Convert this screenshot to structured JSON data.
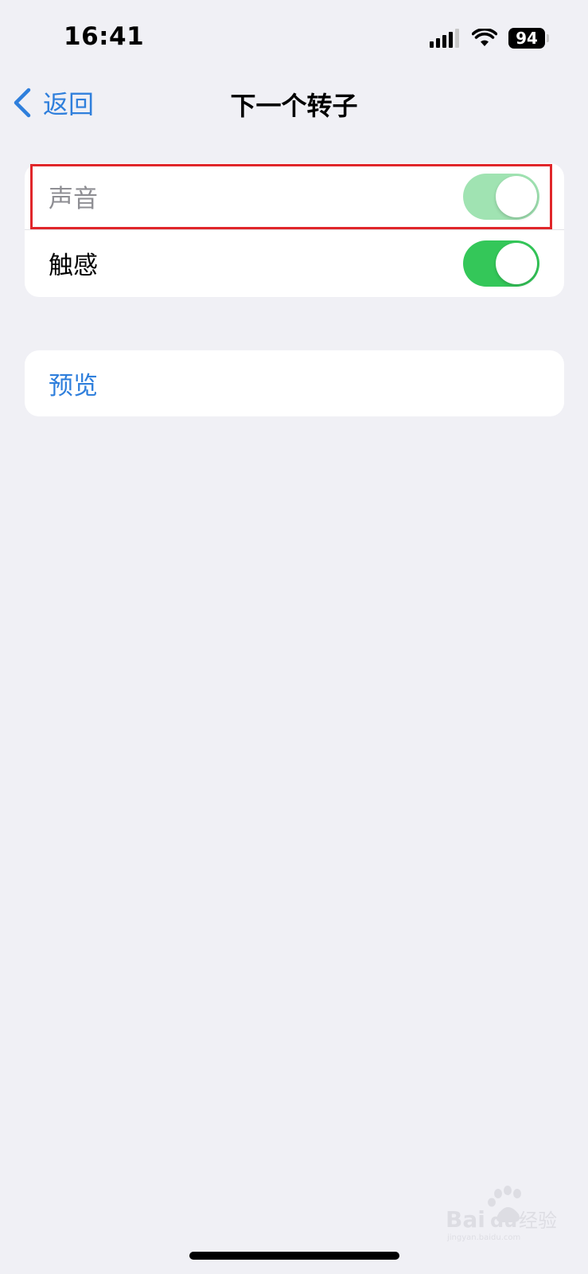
{
  "status_bar": {
    "time": "16:41",
    "battery": "94",
    "icons": [
      "signal-icon",
      "wifi-icon",
      "battery-icon"
    ]
  },
  "nav": {
    "back_label": "返回",
    "title": "下一个转子"
  },
  "group1": {
    "rows": [
      {
        "label": "声音",
        "toggle_on": true,
        "dimmed": true
      },
      {
        "label": "触感",
        "toggle_on": true,
        "dimmed": false
      }
    ]
  },
  "group2": {
    "rows": [
      {
        "label": "预览"
      }
    ]
  },
  "colors": {
    "background": "#f0f0f5",
    "accent_blue": "#2f7fdc",
    "toggle_green": "#34c759",
    "toggle_green_dim": "#a0e3b2",
    "highlight_red": "#e0262a"
  },
  "watermark": {
    "logo_icon": "baidu-paw-icon",
    "brand_text": "Baidu经验",
    "url_text": "jingyan.baidu.com"
  }
}
